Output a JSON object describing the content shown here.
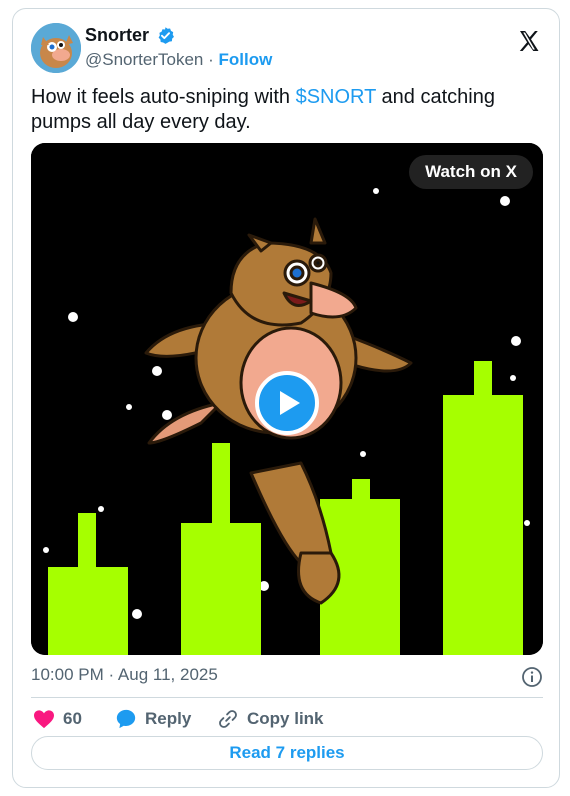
{
  "header": {
    "display_name": "Snorter",
    "handle": "@SnorterToken",
    "separator": "·",
    "follow_label": "Follow"
  },
  "tweet": {
    "text_before": "How it feels auto-sniping with ",
    "cashtag": "$SNORT",
    "text_after": " and catching pumps all day every day."
  },
  "media": {
    "watch_label": "Watch on X"
  },
  "meta": {
    "timestamp": "10:00 PM · Aug 11, 2025"
  },
  "actions": {
    "like_count": "60",
    "reply_label": "Reply",
    "copy_label": "Copy link"
  },
  "footer": {
    "read_replies_label": "Read 7 replies"
  },
  "colors": {
    "accent": "#1d9bf0",
    "like": "#f91880",
    "candle": "#a6ff00",
    "text": "#0f1419",
    "secondary": "#536471"
  },
  "icons": [
    "verified-icon",
    "x-logo-icon",
    "play-icon",
    "info-icon",
    "heart-icon",
    "reply-bubble-icon",
    "link-icon"
  ]
}
